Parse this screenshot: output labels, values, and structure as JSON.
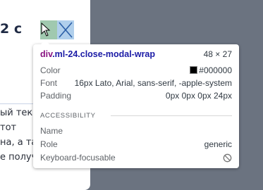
{
  "page": {
    "heading": "2 с",
    "body_lines": [
      "ый текс",
      "тот",
      "на, а та",
      "е получается"
    ]
  },
  "tooltip": {
    "selector_tag": "div",
    "selector_classes": ".ml-24.close-modal-wrap",
    "dimensions": "48 × 27",
    "color_label": "Color",
    "color_value": "#000000",
    "font_label": "Font",
    "font_value": "16px Lato, Arial, sans-serif, -apple-system",
    "padding_label": "Padding",
    "padding_value": "0px 0px 0px 24px",
    "accessibility_title": "ACCESSIBILITY",
    "name_label": "Name",
    "name_value": "",
    "role_label": "Role",
    "role_value": "generic",
    "keyboard_label": "Keyboard-focusable",
    "keyboard_icon": "no-entry-icon"
  },
  "colors": {
    "backdrop": "#6b7380",
    "highlight_content": "#6fa8dc",
    "highlight_padding": "#93c47d",
    "selector_tag": "#881280",
    "selector_class": "#1a1aa6"
  }
}
